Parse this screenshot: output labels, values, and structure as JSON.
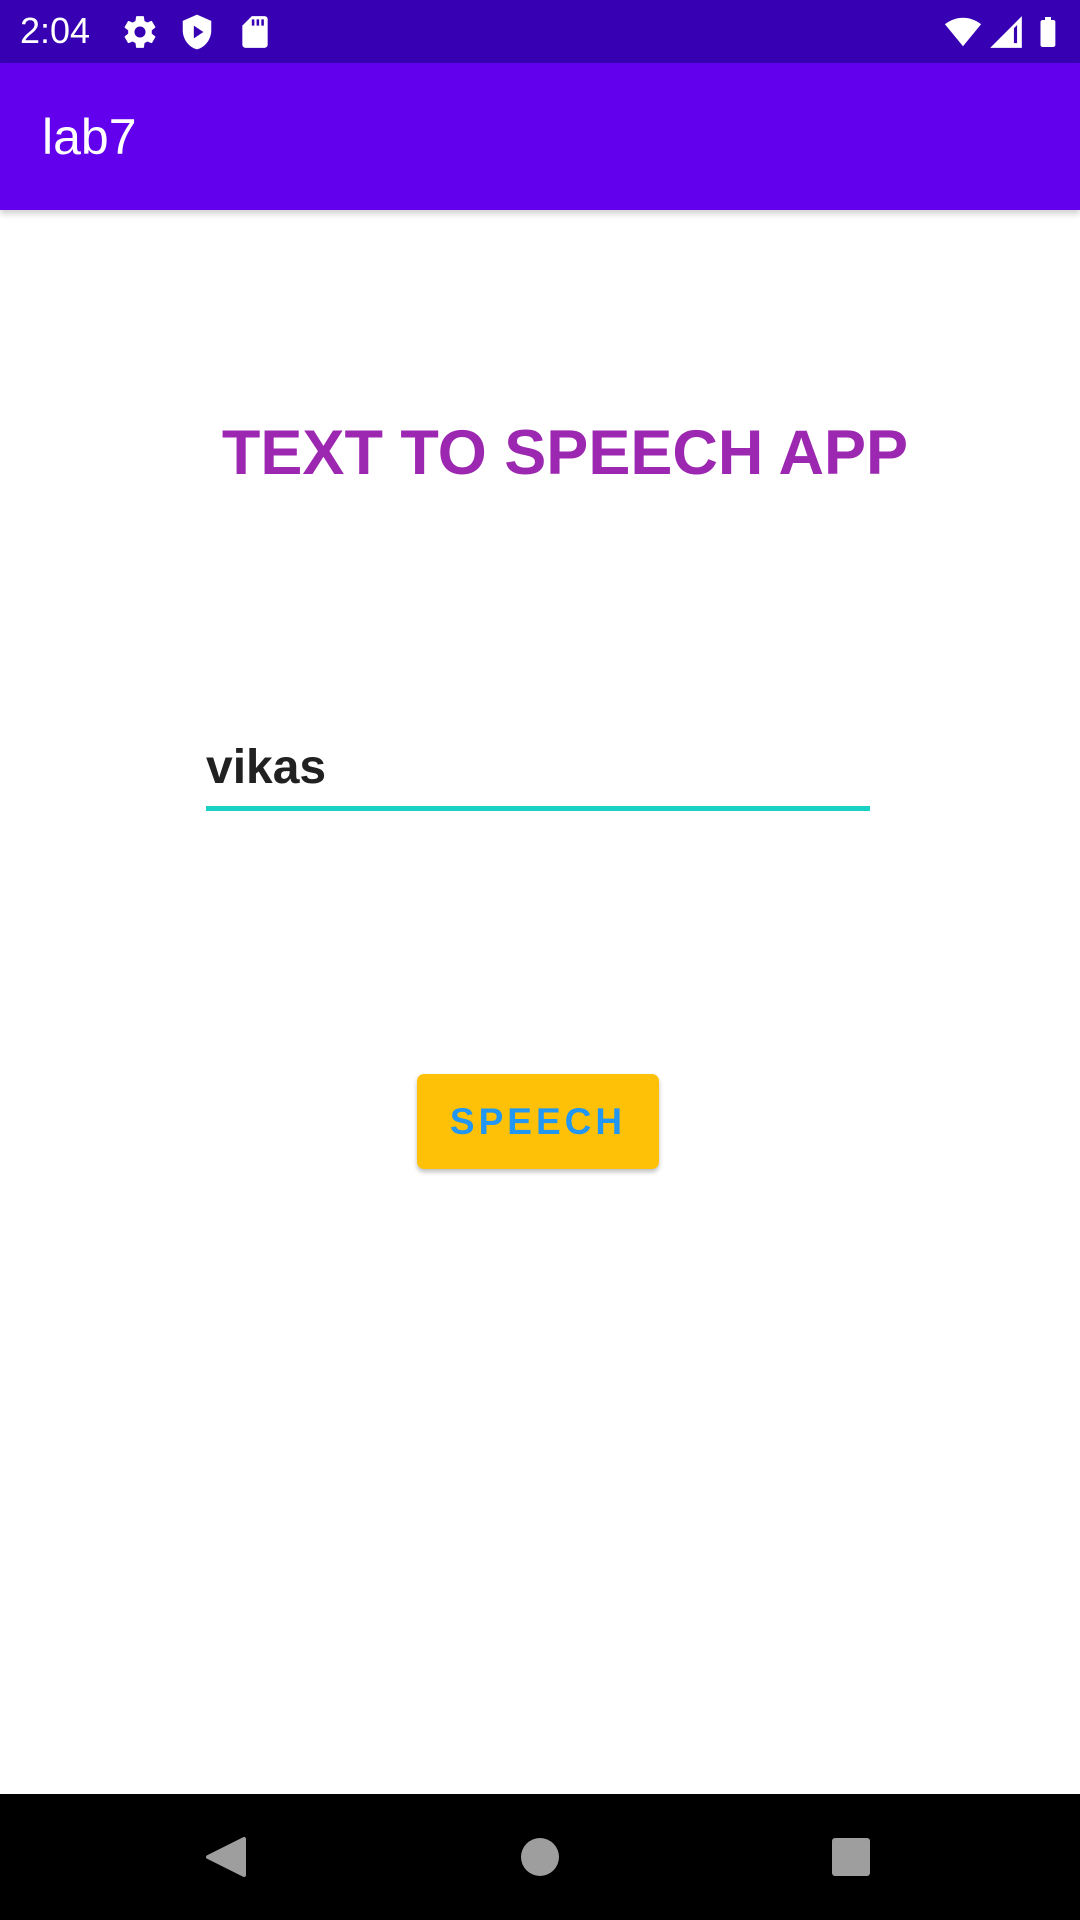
{
  "status_bar": {
    "time": "2:04",
    "icons": [
      "gear-icon",
      "shield-play-icon",
      "sd-card-icon",
      "wifi-icon",
      "signal-icon",
      "battery-icon"
    ],
    "background_color": "#3700b3"
  },
  "app_bar": {
    "title": "lab7",
    "background_color": "#6200ee"
  },
  "main": {
    "heading": "TEXT TO SPEECH APP",
    "heading_color": "#9c27b0",
    "input": {
      "value": "vikas",
      "underline_color": "#1ad1c6"
    },
    "speech_button": {
      "label": "SPEECH",
      "background_color": "#ffc107",
      "text_color": "#2196f3"
    }
  },
  "nav_bar": {
    "buttons": [
      "back-icon",
      "home-icon",
      "recents-icon"
    ]
  }
}
